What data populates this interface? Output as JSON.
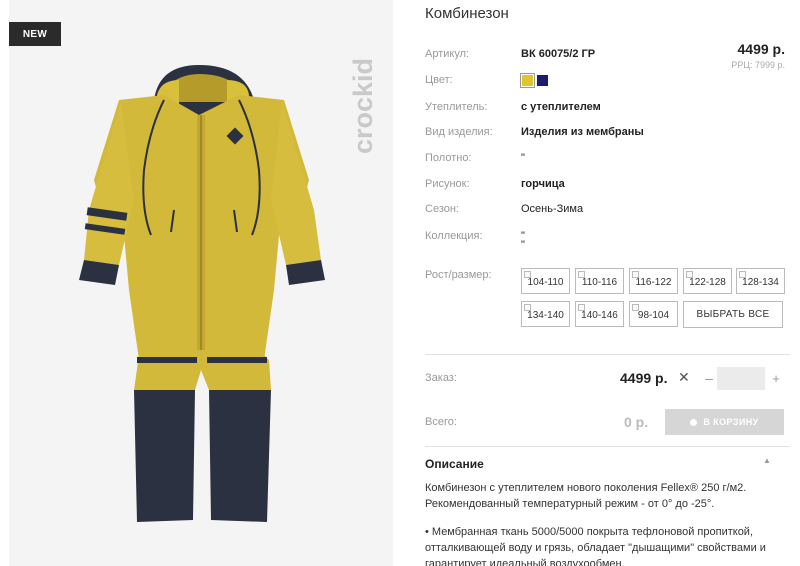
{
  "badge": "NEW",
  "brand": "crockid",
  "product": {
    "title": "Комбинезон",
    "price": "4499 р.",
    "rrp": "РРЦ: 7999 р.",
    "attributes": [
      {
        "label": "Артикул:",
        "value": "ВК 60075/2 ГР",
        "bold": true
      },
      {
        "label": "Цвет:",
        "value": ""
      },
      {
        "label": "Утеплитель:",
        "value": "с утеплителем",
        "bold": true
      },
      {
        "label": "Вид изделия:",
        "value": "Изделия из мембраны",
        "bold": true
      },
      {
        "label": "Полотно:",
        "value": "\""
      },
      {
        "label": "Рисунок:",
        "value": "горчица",
        "bold": true
      },
      {
        "label": "Сезон:",
        "value": "Осень-Зима"
      },
      {
        "label": "Коллекция:",
        "value": "\""
      }
    ],
    "colors": [
      "#e0c52d",
      "#1c1b6e"
    ],
    "collection_extra": "\""
  },
  "sizes": {
    "label": "Рост/размер:",
    "items": [
      "104-110",
      "110-116",
      "116-122",
      "122-128",
      "128-134",
      "134-140",
      "140-146",
      "98-104"
    ],
    "select_all": "ВЫБРАТЬ ВСЕ"
  },
  "order": {
    "label": "Заказ:",
    "price": "4499 р.",
    "times": "✕",
    "minus": "–",
    "plus": "+",
    "qty": ""
  },
  "total": {
    "label": "Всего:",
    "value": "0 р.",
    "cart_button": "В КОРЗИНУ"
  },
  "description": {
    "title": "Описание",
    "caret": "▲",
    "line1": "Комбинезон с утеплителем нового поколения Fellex® 250 г/м2.",
    "line2": "Рекомендованный температурный режим - от 0° до -25°.",
    "line3": "• Мембранная ткань 5000/5000 покрыта тефлоновой пропиткой,",
    "line4": "отталкивающей воду и грязь, обладает \"дышащими\" свойствами и",
    "line5": "гарантирует идеальный воздухообмен."
  }
}
